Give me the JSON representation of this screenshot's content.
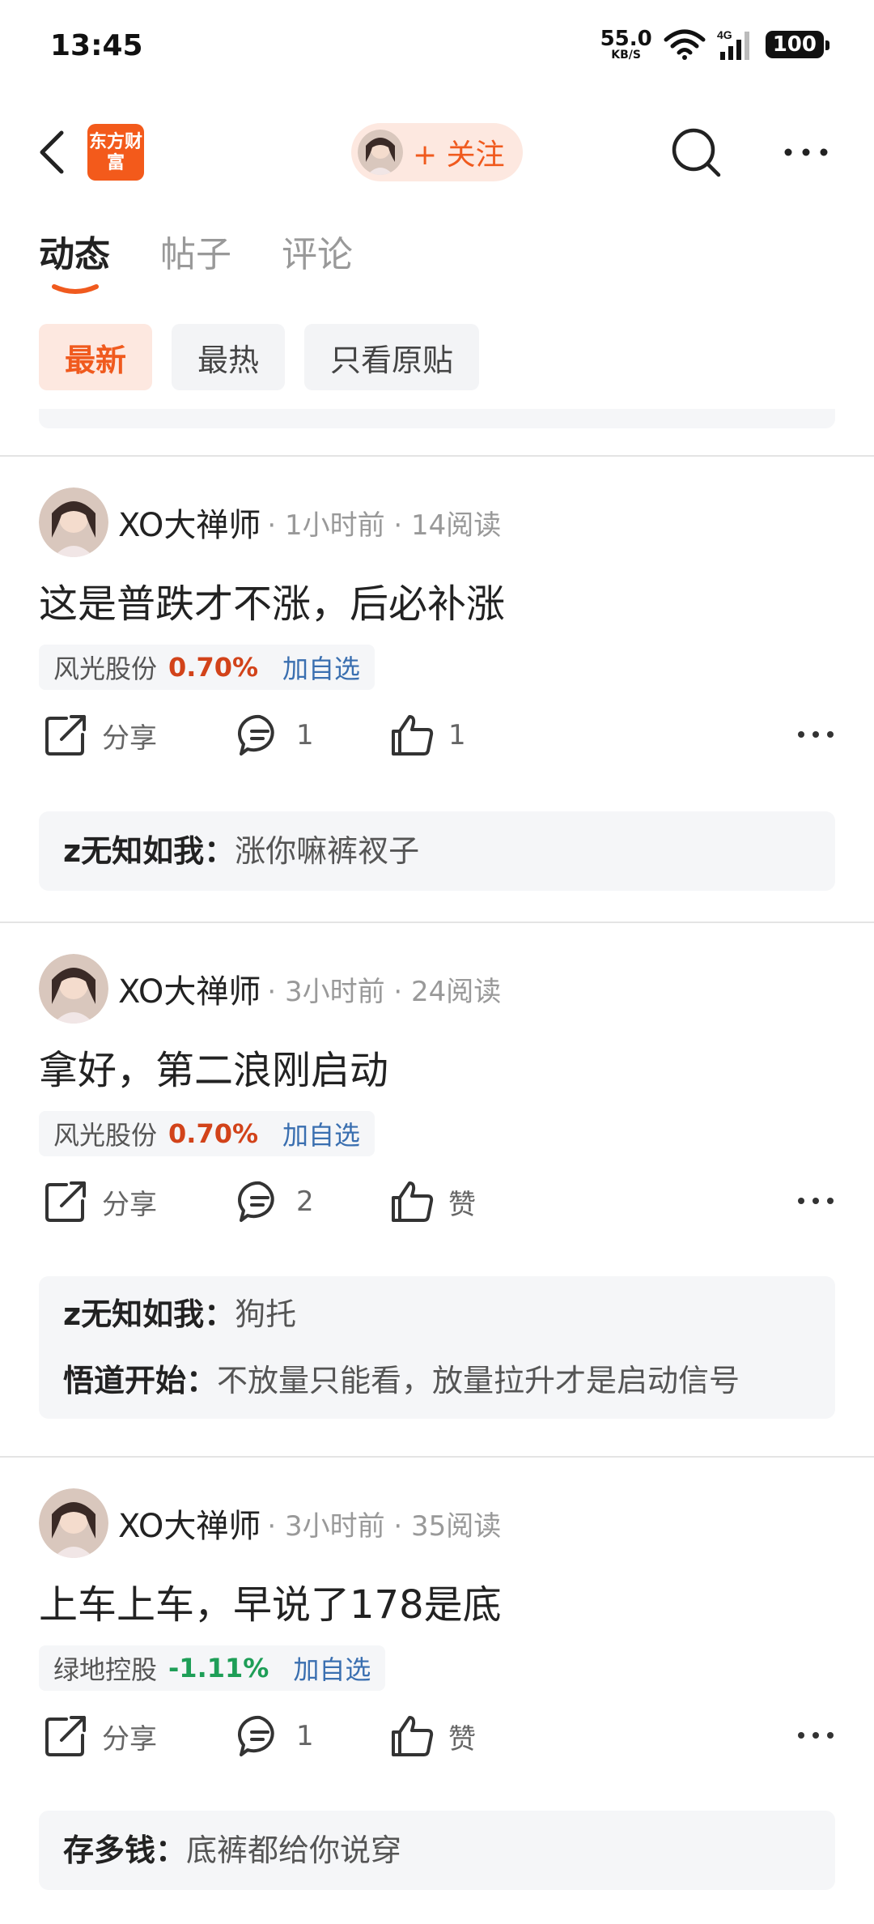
{
  "status_bar": {
    "time": "13:45",
    "net_speed": "55.0",
    "net_unit": "KB/S",
    "signal": "4G",
    "battery": "100"
  },
  "header": {
    "logo_text": "东方财富",
    "follow_label": "+ 关注"
  },
  "tabs": [
    {
      "label": "动态",
      "active": true
    },
    {
      "label": "帖子",
      "active": false
    },
    {
      "label": "评论",
      "active": false
    }
  ],
  "filters": [
    {
      "label": "最新",
      "active": true
    },
    {
      "label": "最热",
      "active": false
    },
    {
      "label": "只看原贴",
      "active": false
    }
  ],
  "colors": {
    "accent": "#f05a1e",
    "up": "#d2431a",
    "down": "#1e9e57",
    "link": "#3a6fb0"
  },
  "posts": [
    {
      "author": "XO大禅师",
      "meta": "· 1小时前 · 14阅读",
      "text": "这是普跌才不涨，后必补涨",
      "stock": {
        "name": "风光股份",
        "change": "0.70%",
        "direction": "up",
        "add_label": "加自选"
      },
      "share_label": "分享",
      "comment_count": "1",
      "like_label": "1",
      "comments": [
        {
          "user": "z无知如我：",
          "text": "涨你嘛裤衩子"
        }
      ]
    },
    {
      "author": "XO大禅师",
      "meta": "· 3小时前 · 24阅读",
      "text": "拿好，第二浪刚启动",
      "stock": {
        "name": "风光股份",
        "change": "0.70%",
        "direction": "up",
        "add_label": "加自选"
      },
      "share_label": "分享",
      "comment_count": "2",
      "like_label": "赞",
      "comments": [
        {
          "user": "z无知如我：",
          "text": "狗托"
        },
        {
          "user": "悟道开始：",
          "text": "不放量只能看，放量拉升才是启动信号"
        }
      ]
    },
    {
      "author": "XO大禅师",
      "meta": "· 3小时前 · 35阅读",
      "text": "上车上车，早说了178是底",
      "stock": {
        "name": "绿地控股",
        "change": "-1.11%",
        "direction": "down",
        "add_label": "加自选"
      },
      "share_label": "分享",
      "comment_count": "1",
      "like_label": "赞",
      "comments": [
        {
          "user": "存多钱：",
          "text": "底裤都给你说穿"
        }
      ]
    }
  ]
}
